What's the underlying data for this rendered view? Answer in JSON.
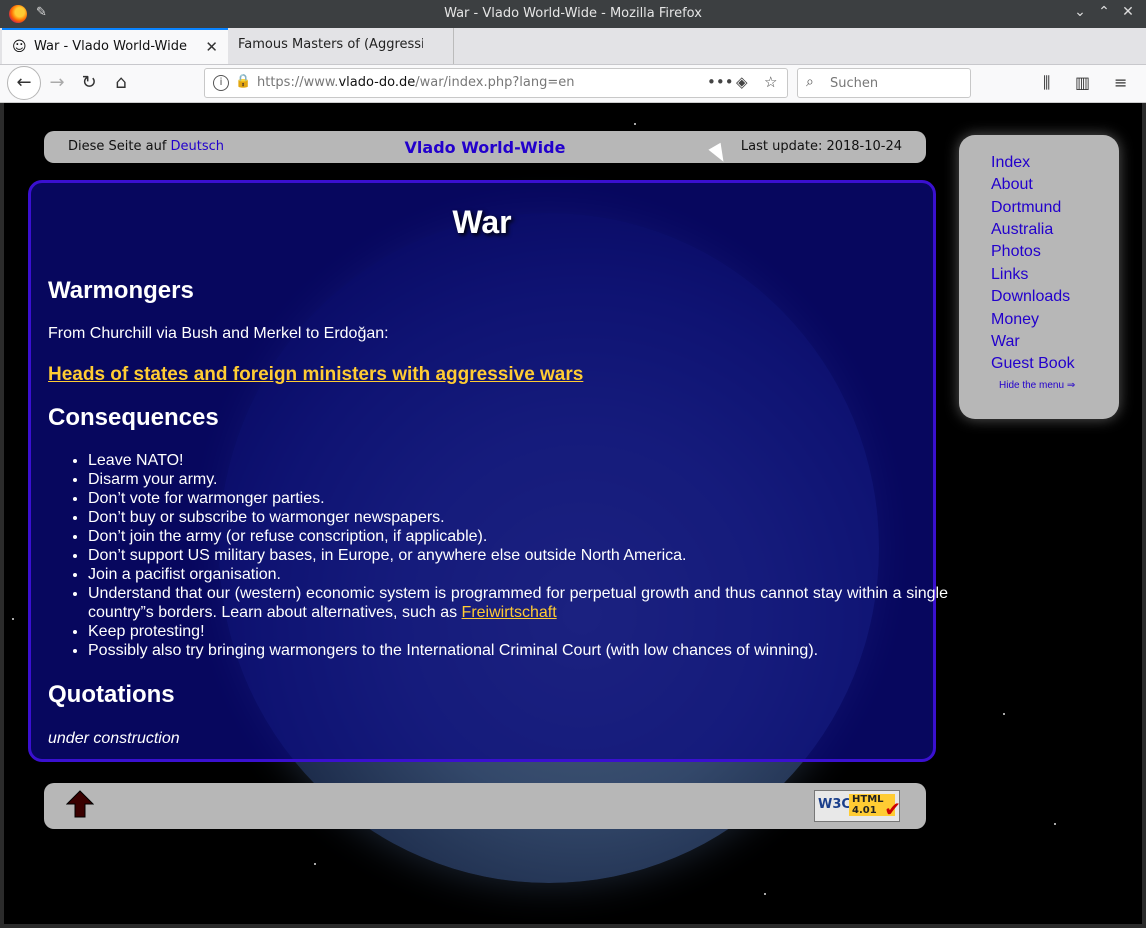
{
  "window": {
    "title": "War - Vlado World-Wide - Mozilla Firefox"
  },
  "tabs": [
    {
      "label": "War - Vlado World-Wide",
      "active": true
    },
    {
      "label": "Famous Masters of (Aggressive",
      "active": false
    }
  ],
  "address": {
    "url_prefix": "https://www.",
    "url_host": "vlado-do.de",
    "url_path": "/war/index.php?lang=en"
  },
  "search": {
    "placeholder": "Suchen"
  },
  "page": {
    "header": {
      "lang_text": "Diese Seite auf",
      "lang_link": "Deutsch",
      "site_title": "Vlado World-Wide",
      "last_update": "Last update: 2018-10-24"
    },
    "title": "War",
    "warmongers_heading": "Warmongers",
    "intro": "From Churchill via Bush and Merkel to Erdoğan:",
    "heads_link": "Heads of states and foreign ministers with aggressive wars",
    "consequences_heading": "Consequences",
    "consequences": [
      "Leave NATO!",
      "Disarm your army.",
      "Don’t vote for warmonger parties.",
      "Don’t buy or subscribe to warmonger newspapers.",
      "Don’t join the army (or refuse conscription, if applicable).",
      "Don’t support US military bases, in Europe, or anywhere else outside North America.",
      "Join a pacifist organisation.",
      "Understand that our (western) economic system is programmed for perpetual growth and thus cannot stay within a single country”s borders. Learn about alternatives, such as",
      "Keep protesting!",
      "Possibly also try bringing warmongers to the International Criminal Court (with low chances of winning)."
    ],
    "freiwirtschaft_link": "Freiwirtschaft",
    "quotations_heading": "Quotations",
    "quotations_text": "under construction",
    "w3c": {
      "w": "W3C",
      "html": "HTML",
      "ver": "4.01"
    }
  },
  "menu": {
    "items": [
      "Index",
      "About",
      "Dortmund",
      "Australia",
      "Photos",
      "Links",
      "Downloads",
      "Money",
      "War",
      "Guest Book"
    ],
    "hide": "Hide the menu ⇒"
  }
}
